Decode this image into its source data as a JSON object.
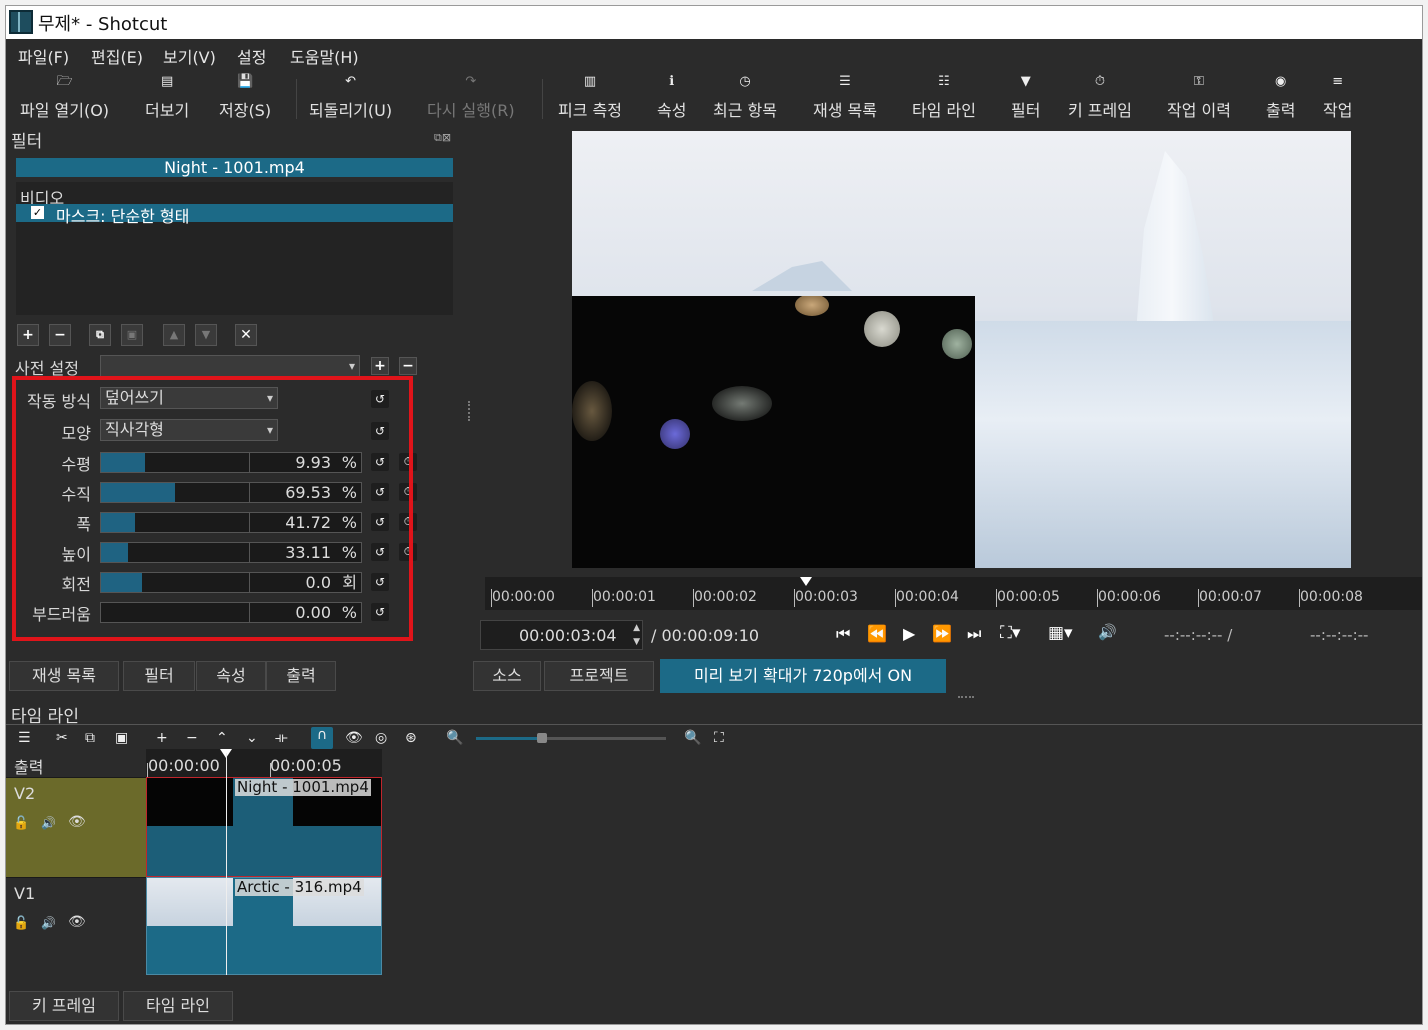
{
  "window": {
    "title": "무제* - Shotcut"
  },
  "menu": [
    "파일(F)",
    "편집(E)",
    "보기(V)",
    "설정",
    "도움말(H)"
  ],
  "toolbar": [
    {
      "label": "파일 열기(O)",
      "icon": "folder-open-icon",
      "glyph": "🗁",
      "enabled": true
    },
    {
      "label": "더보기",
      "icon": "file-plus-icon",
      "glyph": "▤",
      "enabled": true
    },
    {
      "label": "저장(S)",
      "icon": "save-icon",
      "glyph": "💾",
      "enabled": true
    },
    {
      "label": "되돌리기(U)",
      "icon": "undo-icon",
      "glyph": "↶",
      "enabled": true
    },
    {
      "label": "다시 실행(R)",
      "icon": "redo-icon",
      "glyph": "↷",
      "enabled": false
    },
    {
      "label": "피크 측정",
      "icon": "peak-meter-icon",
      "glyph": "▥",
      "enabled": true
    },
    {
      "label": "속성",
      "icon": "info-icon",
      "glyph": "ℹ",
      "enabled": true
    },
    {
      "label": "최근 항목",
      "icon": "clock-icon",
      "glyph": "◷",
      "enabled": true
    },
    {
      "label": "재생 목록",
      "icon": "list-icon",
      "glyph": "☰",
      "enabled": true
    },
    {
      "label": "타임 라인",
      "icon": "timeline-icon",
      "glyph": "☷",
      "enabled": true
    },
    {
      "label": "필터",
      "icon": "funnel-icon",
      "glyph": "▼",
      "enabled": true
    },
    {
      "label": "키 프레임",
      "icon": "stopwatch-icon",
      "glyph": "⏱",
      "enabled": true
    },
    {
      "label": "작업 이력",
      "icon": "key-icon",
      "glyph": "⚿",
      "enabled": true
    },
    {
      "label": "출력",
      "icon": "export-icon",
      "glyph": "◉",
      "enabled": true
    },
    {
      "label": "작업",
      "icon": "jobs-icon",
      "glyph": "≡",
      "enabled": true
    }
  ],
  "filters": {
    "panel_title": "필터",
    "clip_name": "Night - 1001.mp4",
    "section": "비디오",
    "filter_item": "마스크: 단순한 형태",
    "preset_label": "사전 설정",
    "preset_value": "",
    "operation_label": "작동 방식",
    "operation_value": "덮어쓰기",
    "shape_label": "모양",
    "shape_value": "직사각형",
    "params": [
      {
        "label": "수평",
        "value": "9.93",
        "unit": "%",
        "fill": 0.3,
        "keyframe": true
      },
      {
        "label": "수직",
        "value": "69.53",
        "unit": "%",
        "fill": 0.5,
        "keyframe": true
      },
      {
        "label": "폭",
        "value": "41.72",
        "unit": "%",
        "fill": 0.23,
        "keyframe": true
      },
      {
        "label": "높이",
        "value": "33.11",
        "unit": "%",
        "fill": 0.18,
        "keyframe": true
      },
      {
        "label": "회전",
        "value": "0.0",
        "unit": "회",
        "fill": 0.28,
        "keyframe": false
      },
      {
        "label": "부드러움",
        "value": "0.00",
        "unit": "%",
        "fill": 0.0,
        "keyframe": false
      }
    ]
  },
  "left_tabs": [
    "재생 목록",
    "필터",
    "속성",
    "출력"
  ],
  "player": {
    "ruler": [
      "00:00:00",
      "00:00:01",
      "00:00:02",
      "00:00:03",
      "00:00:04",
      "00:00:05",
      "00:00:06",
      "00:00:07",
      "00:00:08"
    ],
    "current_time": "00:00:03:04",
    "duration": "/ 00:00:09:10",
    "in_point": "--:--:--:-- /",
    "out_point": "--:--:--:--",
    "tabs": [
      "소스",
      "프로젝트"
    ],
    "zoom_notice": "미리 보기 확대가 720p에서 ON"
  },
  "timeline": {
    "title": "타임 라인",
    "ruler": [
      "00:00:00",
      "00:00:05"
    ],
    "output_label": "출력",
    "tracks": [
      {
        "name": "V2",
        "clip": "Night - 1001.mp4"
      },
      {
        "name": "V1",
        "clip": "Arctic - 316.mp4"
      }
    ]
  },
  "bottom_tabs": [
    "키 프레임",
    "타임 라인"
  ],
  "colors": {
    "accent": "#1c6a87",
    "highlight": "#e0141a",
    "track_selected": "#6b6a2a"
  }
}
